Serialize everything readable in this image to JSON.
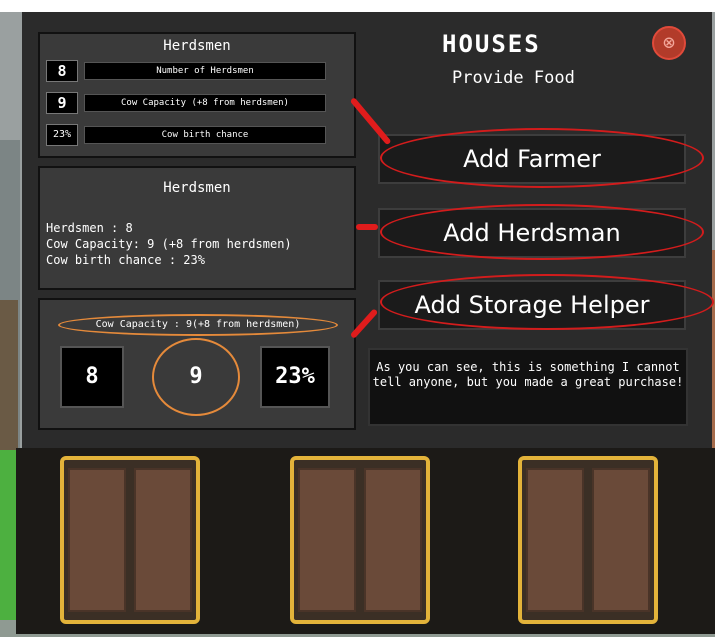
{
  "window": {
    "title": "HOUSES",
    "subtitle": "Provide Food",
    "close_label": "⊗"
  },
  "box1": {
    "title": "Herdsmen",
    "rows": [
      {
        "value": "8",
        "label": "Number of Herdsmen"
      },
      {
        "value": "9",
        "label": "Cow Capacity (+8 from herdsmen)"
      },
      {
        "value": "23%",
        "label": "Cow birth chance"
      }
    ]
  },
  "box2": {
    "title": "Herdsmen",
    "line1": "Herdsmen : 8",
    "line2": "Cow Capacity: 9 (+8 from herdsmen)",
    "line3": "Cow birth chance : 23%"
  },
  "box3": {
    "capacity_label": "Cow Capacity : 9(+8 from herdsmen)",
    "stats": [
      "8",
      "9",
      "23%"
    ]
  },
  "buttons": {
    "add_farmer": "Add Farmer",
    "add_herdsman": "Add Herdsman",
    "add_storage": "Add Storage Helper"
  },
  "description": "As you can see, this is something I cannot tell anyone, but you made a great purchase!",
  "colors": {
    "highlight_orange": "#e58a3a",
    "annotation_red": "#d31c1c",
    "slot_gold": "#e3b33a"
  }
}
